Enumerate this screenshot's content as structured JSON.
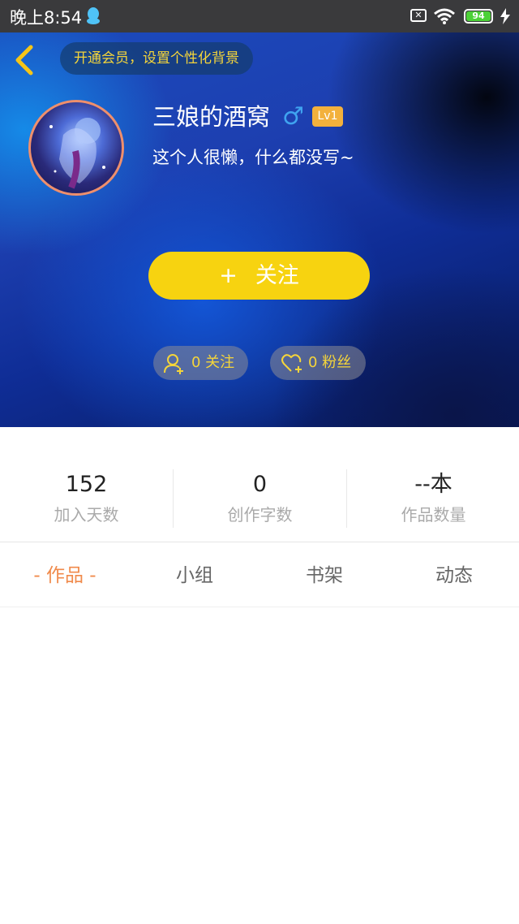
{
  "status_bar": {
    "time": "晚上8:54",
    "battery": "94"
  },
  "header": {
    "vip_banner": "开通会员，设置个性化背景"
  },
  "profile": {
    "name": "三娘的酒窝",
    "gender_symbol": "♂",
    "level": "Lv1",
    "bio": "这个人很懒，什么都没写~",
    "follow_button": {
      "icon": "+",
      "label": "关注"
    },
    "following": "0 关注",
    "fans": "0 粉丝"
  },
  "stats": [
    {
      "value": "152",
      "label": "加入天数"
    },
    {
      "value": "0",
      "label": "创作字数"
    },
    {
      "value": "--本",
      "label": "作品数量"
    }
  ],
  "tabs": [
    {
      "label": "- 作品 -",
      "active": true
    },
    {
      "label": "小组",
      "active": false
    },
    {
      "label": "书架",
      "active": false
    },
    {
      "label": "动态",
      "active": false
    }
  ],
  "colors": {
    "accent": "#f7d310",
    "tab_active": "#f08a4b",
    "level_badge": "#f3b13c",
    "gender": "#3fa3f0"
  }
}
